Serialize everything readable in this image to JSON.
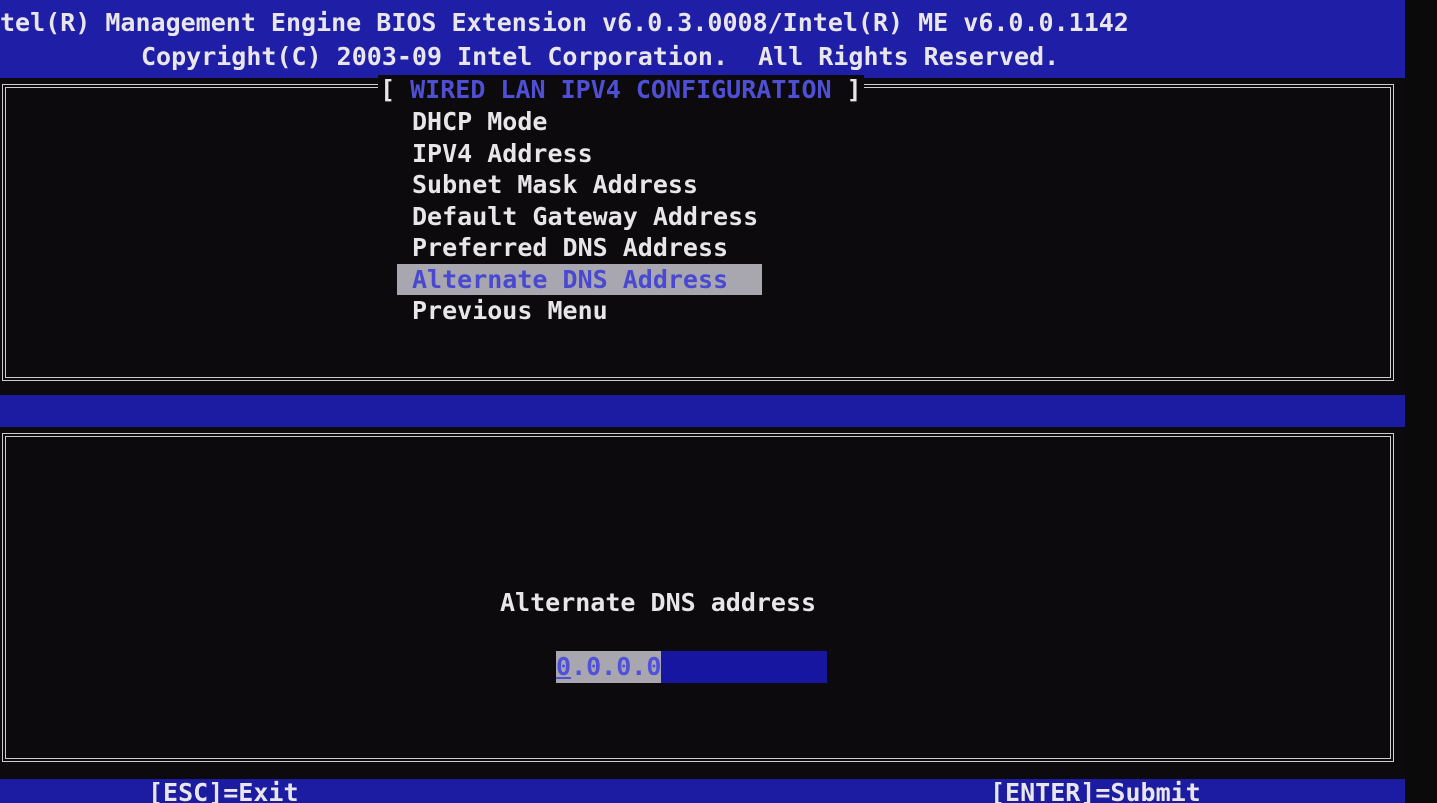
{
  "header": {
    "line1": "tel(R) Management Engine BIOS Extension v6.0.3.0008/Intel(R) ME v6.0.0.1142",
    "line2": "Copyright(C) 2003-09 Intel Corporation.  All Rights Reserved."
  },
  "panel": {
    "title_open": "[ ",
    "title": "WIRED LAN IPV4 CONFIGURATION",
    "title_close": " ]"
  },
  "menu": {
    "items": [
      {
        "label": "DHCP Mode",
        "selected": false
      },
      {
        "label": "IPV4 Address",
        "selected": false
      },
      {
        "label": "Subnet Mask Address",
        "selected": false
      },
      {
        "label": "Default Gateway Address",
        "selected": false
      },
      {
        "label": "Preferred DNS Address",
        "selected": false
      },
      {
        "label": "Alternate DNS Address",
        "selected": true
      },
      {
        "label": "Previous Menu",
        "selected": false
      }
    ]
  },
  "prompt": {
    "label": "Alternate DNS address",
    "value_first": "0",
    "value_rest": ".0.0.0"
  },
  "footer": {
    "left": "[ESC]=Exit",
    "right": "[ENTER]=Submit"
  },
  "colors": {
    "bar_blue": "#1c1ca2",
    "highlight_gray": "#a8a7b0",
    "highlight_text": "#4848d0",
    "background": "#0c0a0c"
  }
}
